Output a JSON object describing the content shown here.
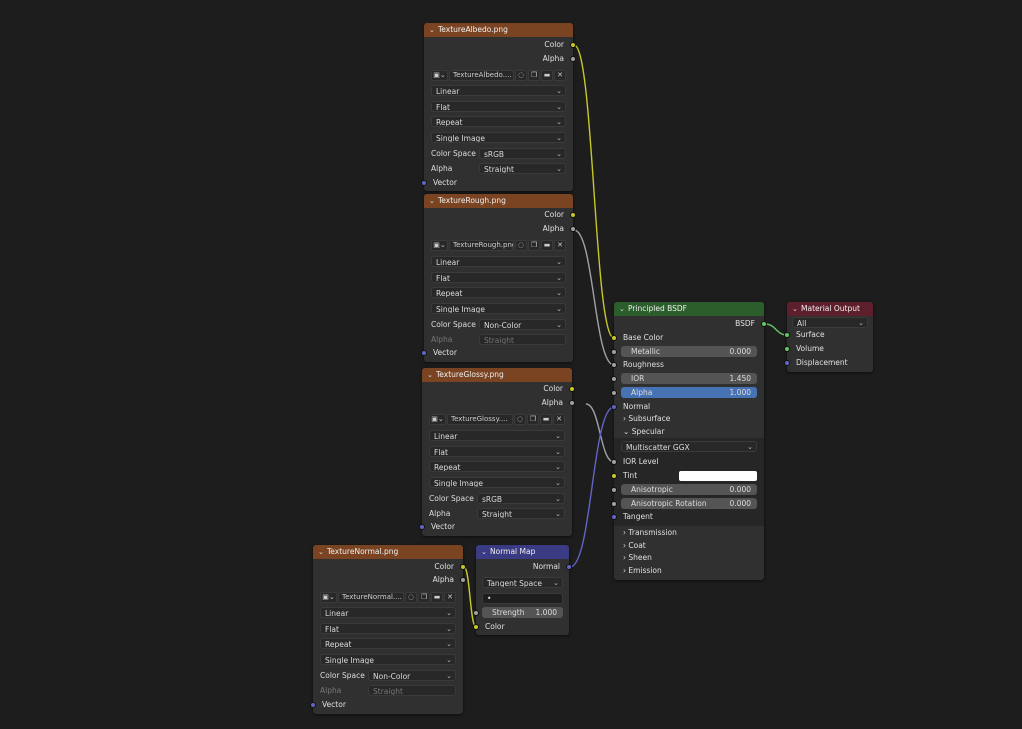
{
  "colors": {
    "background": "#1d1d1d",
    "texture_header": "#7a4422",
    "bsdf_header": "#2c5e2c",
    "output_header": "#5e1f2c",
    "vector_header": "#3b3b84",
    "socket_color": "#c7c729",
    "socket_float": "#a1a1a1",
    "socket_vector": "#6363c7",
    "socket_shader": "#62c762"
  },
  "icons": {
    "image": "image-icon",
    "chevron": "chevron-down-icon",
    "fake_user": "shield-icon",
    "duplicate": "duplicate-icon",
    "folder": "folder-icon",
    "close": "close-icon"
  },
  "texture_albedo": {
    "title": "TextureAlbedo.png",
    "out_color": "Color",
    "out_alpha": "Alpha",
    "image_name": "TextureAlbedo....",
    "interpolation": "Linear",
    "projection": "Flat",
    "extension": "Repeat",
    "source": "Single Image",
    "color_space_label": "Color Space",
    "color_space": "sRGB",
    "alpha_label": "Alpha",
    "alpha_mode": "Straight",
    "in_vector": "Vector"
  },
  "texture_rough": {
    "title": "TextureRough.png",
    "out_color": "Color",
    "out_alpha": "Alpha",
    "image_name": "TextureRough.png",
    "interpolation": "Linear",
    "projection": "Flat",
    "extension": "Repeat",
    "source": "Single Image",
    "color_space_label": "Color Space",
    "color_space": "Non-Color",
    "alpha_label": "Alpha",
    "alpha_mode": "Straight",
    "in_vector": "Vector"
  },
  "texture_glossy": {
    "title": "TextureGlossy.png",
    "out_color": "Color",
    "out_alpha": "Alpha",
    "image_name": "TextureGlossy....",
    "interpolation": "Linear",
    "projection": "Flat",
    "extension": "Repeat",
    "source": "Single Image",
    "color_space_label": "Color Space",
    "color_space": "sRGB",
    "alpha_label": "Alpha",
    "alpha_mode": "Straight",
    "in_vector": "Vector"
  },
  "texture_normal": {
    "title": "TextureNormal.png",
    "out_color": "Color",
    "out_alpha": "Alpha",
    "image_name": "TextureNormal....",
    "interpolation": "Linear",
    "projection": "Flat",
    "extension": "Repeat",
    "source": "Single Image",
    "color_space_label": "Color Space",
    "color_space": "Non-Color",
    "alpha_label": "Alpha",
    "alpha_mode": "Straight",
    "in_vector": "Vector"
  },
  "normal_map": {
    "title": "Normal Map",
    "out_normal": "Normal",
    "space": "Tangent Space",
    "uv_placeholder": "•",
    "strength_label": "Strength",
    "strength": "1.000",
    "in_color": "Color"
  },
  "bsdf": {
    "title": "Principled BSDF",
    "out_bsdf": "BSDF",
    "base_color": "Base Color",
    "metallic_label": "Metallic",
    "metallic": "0.000",
    "roughness": "Roughness",
    "ior_label": "IOR",
    "ior": "1.450",
    "alpha_label": "Alpha",
    "alpha": "1.000",
    "normal": "Normal",
    "subsurface": "Subsurface",
    "specular": "Specular",
    "distribution": "Multiscatter GGX",
    "ior_level": "IOR Level",
    "tint": "Tint",
    "anisotropic_label": "Anisotropic",
    "anisotropic": "0.000",
    "aniso_rotation_label": "Anisotropic Rotation",
    "aniso_rotation": "0.000",
    "tangent": "Tangent",
    "transmission": "Transmission",
    "coat": "Coat",
    "sheen": "Sheen",
    "emission": "Emission"
  },
  "material_output": {
    "title": "Material Output",
    "target": "All",
    "in_surface": "Surface",
    "in_volume": "Volume",
    "in_displacement": "Displacement"
  }
}
